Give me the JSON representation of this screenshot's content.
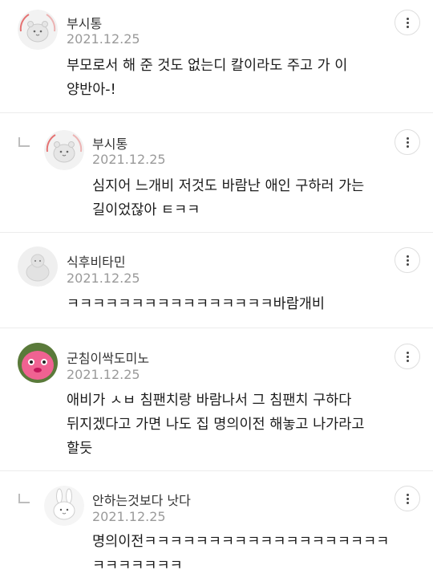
{
  "comments": [
    {
      "author": "부시통",
      "date": "2021.12.25",
      "avatar": "hamster-avatar",
      "is_reply": false,
      "lines": [
        "부모로서 해 준 것도 없는디 칼이라도 주고 가 이",
        "양반아-!"
      ]
    },
    {
      "author": "부시통",
      "date": "2021.12.25",
      "avatar": "hamster-avatar",
      "is_reply": true,
      "lines": [
        "심지어 느개비 저것도 바람난 애인 구하러 가는",
        "길이었잖아 ㅌㅋㅋ"
      ]
    },
    {
      "author": "식후비타민",
      "date": "2021.12.25",
      "avatar": "default-avatar",
      "is_reply": false,
      "lines": [
        "ㅋㅋㅋㅋㅋㅋㅋㅋㅋㅋㅋㅋㅋㅋㅋㅋ바람개비"
      ]
    },
    {
      "author": "군침이싹도미노",
      "date": "2021.12.25",
      "avatar": "pink-character-avatar",
      "is_reply": false,
      "lines": [
        "애비가 ㅅㅂ 침팬치랑 바람나서 그 침팬치 구하다",
        "뒤지겠다고 가면 나도 집 명의이전 해놓고 나가라고",
        "할듯"
      ]
    },
    {
      "author": "안하는것보다 낫다",
      "date": "2021.12.25",
      "avatar": "rabbit-avatar",
      "is_reply": true,
      "lines": [
        "명의이전ㅋㅋㅋㅋㅋㅋㅋㅋㅋㅋㅋㅋㅋㅋㅋㅋㅋㅋㅋ",
        "ㅋㅋㅋㅋㅋㅋㅋ"
      ]
    }
  ],
  "icons": {
    "more": "more-vertical-icon",
    "reply": "reply-arrow-icon"
  },
  "colors": {
    "text": "#1b1b1b",
    "meta": "#9a9a9a",
    "divider": "#ececec",
    "avatar_ring": "#e57373",
    "pink_avatar": "#f06292"
  }
}
